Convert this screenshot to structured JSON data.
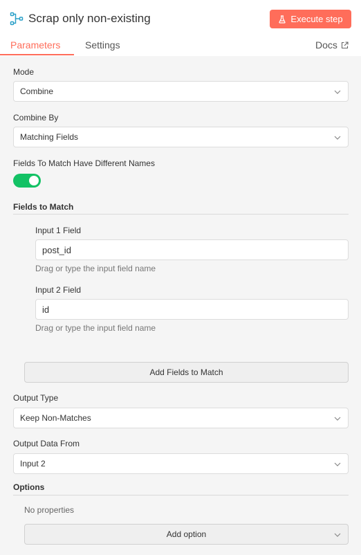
{
  "header": {
    "title": "Scrap only non-existing",
    "execute_label": "Execute step",
    "tabs": [
      "Parameters",
      "Settings"
    ],
    "docs_label": "Docs",
    "accent_color": "#ff6d5a"
  },
  "form": {
    "mode": {
      "label": "Mode",
      "value": "Combine"
    },
    "combine_by": {
      "label": "Combine By",
      "value": "Matching Fields"
    },
    "different_names": {
      "label": "Fields To Match Have Different Names",
      "enabled": true,
      "on_color": "#13c265"
    },
    "fields_to_match": {
      "label": "Fields to Match",
      "input1": {
        "label": "Input 1 Field",
        "value": "post_id",
        "hint": "Drag or type the input field name"
      },
      "input2": {
        "label": "Input 2 Field",
        "value": "id",
        "hint": "Drag or type the input field name"
      },
      "add_button": "Add Fields to Match"
    },
    "output_type": {
      "label": "Output Type",
      "value": "Keep Non-Matches"
    },
    "output_data_from": {
      "label": "Output Data From",
      "value": "Input 2"
    },
    "options": {
      "label": "Options",
      "empty_text": "No properties",
      "add_button": "Add option"
    }
  },
  "icons": {
    "title_icon": "merge-node-icon",
    "execute_icon": "flask-icon",
    "docs_icon": "external-link-icon",
    "dropdown_icon": "chevron-down-icon"
  }
}
